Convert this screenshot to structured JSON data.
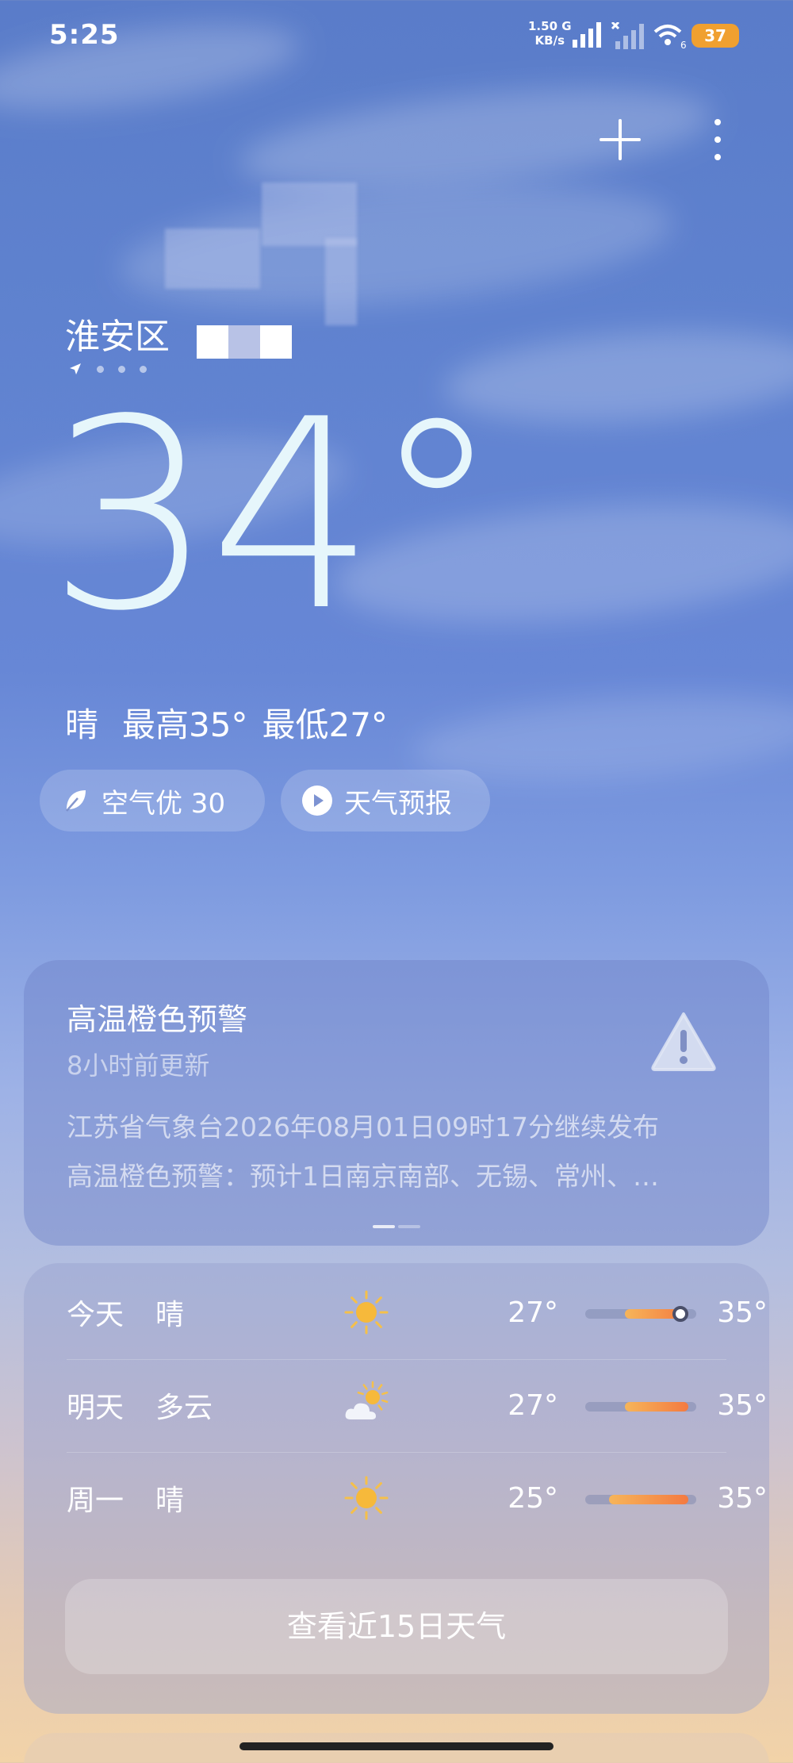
{
  "status_bar": {
    "time": "5:25",
    "net_speed_value": "1.50 G",
    "net_speed_unit": "KB/s",
    "sim2_label": "6",
    "battery": "37",
    "battery_color": "#f0a030"
  },
  "location": {
    "name": "淮安区"
  },
  "current": {
    "temperature": "34°",
    "condition": "晴",
    "high": "最高35°",
    "low": "最低27°"
  },
  "pills": {
    "air_quality": "空气优 30",
    "video_forecast": "天气预报"
  },
  "alert": {
    "title": "高温橙色预警",
    "updated": "8小时前更新",
    "line1": "江苏省气象台2026年08月01日09时17分继续发布",
    "line2": "高温橙色预警：预计1日南京南部、无锡、常州、…"
  },
  "forecast": {
    "days": [
      {
        "day": "今天",
        "condition": "晴",
        "icon": "sun-icon",
        "low": "27°",
        "high": "35°",
        "low_value": 27,
        "high_value": 35,
        "current_value": 34
      },
      {
        "day": "明天",
        "condition": "多云",
        "icon": "partly-cloudy-icon",
        "low": "27°",
        "high": "35°",
        "low_value": 27,
        "high_value": 35
      },
      {
        "day": "周一",
        "condition": "晴",
        "icon": "sun-icon",
        "low": "25°",
        "high": "35°",
        "low_value": 25,
        "high_value": 35
      }
    ],
    "range_min": 22,
    "range_max": 36,
    "view_15_days": "查看近15日天气"
  }
}
